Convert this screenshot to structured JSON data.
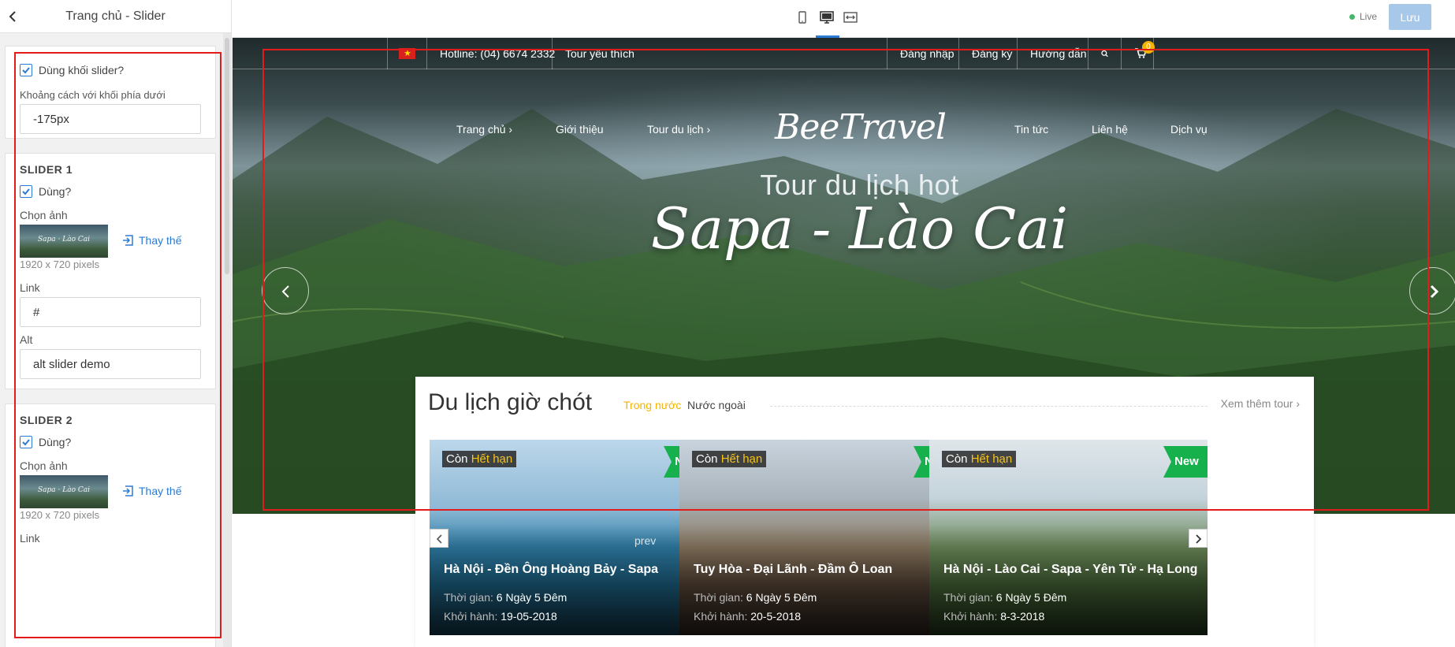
{
  "sidebar": {
    "title": "Trang chủ - Slider",
    "use_slider_label": "Dùng khối slider?",
    "spacing_label": "Khoảng cách với khối phía dưới",
    "spacing_value": "-175px",
    "slider1": {
      "heading": "SLIDER 1",
      "use_label": "Dùng?",
      "image_label": "Chọn ảnh",
      "replace_label": "Thay thế",
      "dimensions": "1920 x 720 pixels",
      "link_label": "Link",
      "link_value": "#",
      "alt_label": "Alt",
      "alt_value": "alt slider demo"
    },
    "slider2": {
      "heading": "SLIDER 2",
      "use_label": "Dùng?",
      "image_label": "Chọn ảnh",
      "replace_label": "Thay thế",
      "dimensions": "1920 x 720 pixels",
      "link_label": "Link"
    }
  },
  "toolbar": {
    "live_label": "Live",
    "save_label": "Lưu",
    "devices": [
      "mobile-icon",
      "desktop-icon",
      "fullwidth-icon"
    ],
    "active_device": "desktop-icon"
  },
  "site": {
    "utility": {
      "hotline": "Hotline: (04) 6674 2332",
      "favorites": "Tour yêu thích",
      "login": "Đăng nhập",
      "register": "Đăng ký",
      "guide": "Hướng dẫn",
      "cart_count": "0"
    },
    "nav": {
      "home": "Trang chủ ›",
      "about": "Giới thiệu",
      "tours": "Tour du lịch ›",
      "logo": "BeeTravel",
      "news": "Tin tức",
      "contact": "Liên hệ",
      "services": "Dịch vụ"
    },
    "hero": {
      "subtitle": "Tour du lịch hot",
      "title": "Sapa - Lào Cai"
    },
    "tours": {
      "heading": "Du lịch giờ chót",
      "tab_domestic": "Trong nước",
      "tab_foreign": "Nước ngoài",
      "more": "Xem thêm tour ›",
      "prev_label": "prev",
      "remaining_label": "Còn",
      "expired_label": "Hết hạn",
      "new_label": "New",
      "time_label": "Thời gian:",
      "depart_label": "Khởi hành:",
      "items": [
        {
          "name": "Hà Nội - Đền Ông Hoàng Bảy - Sapa",
          "duration": "6 Ngày 5 Đêm",
          "departure": "19-05-2018"
        },
        {
          "name": "Tuy Hòa - Đại Lãnh - Đầm Ô Loan",
          "duration": "6 Ngày 5 Đêm",
          "departure": "20-5-2018"
        },
        {
          "name": "Hà Nội - Lào Cai - Sapa - Yên Tử - Hạ Long",
          "duration": "6 Ngày 5 Đêm",
          "departure": "8-3-2018"
        }
      ]
    }
  },
  "colors": {
    "accent": "#2b7bd3",
    "highlight": "#f5c218",
    "new_badge": "#16b04c",
    "annotation": "#e21b1b"
  }
}
